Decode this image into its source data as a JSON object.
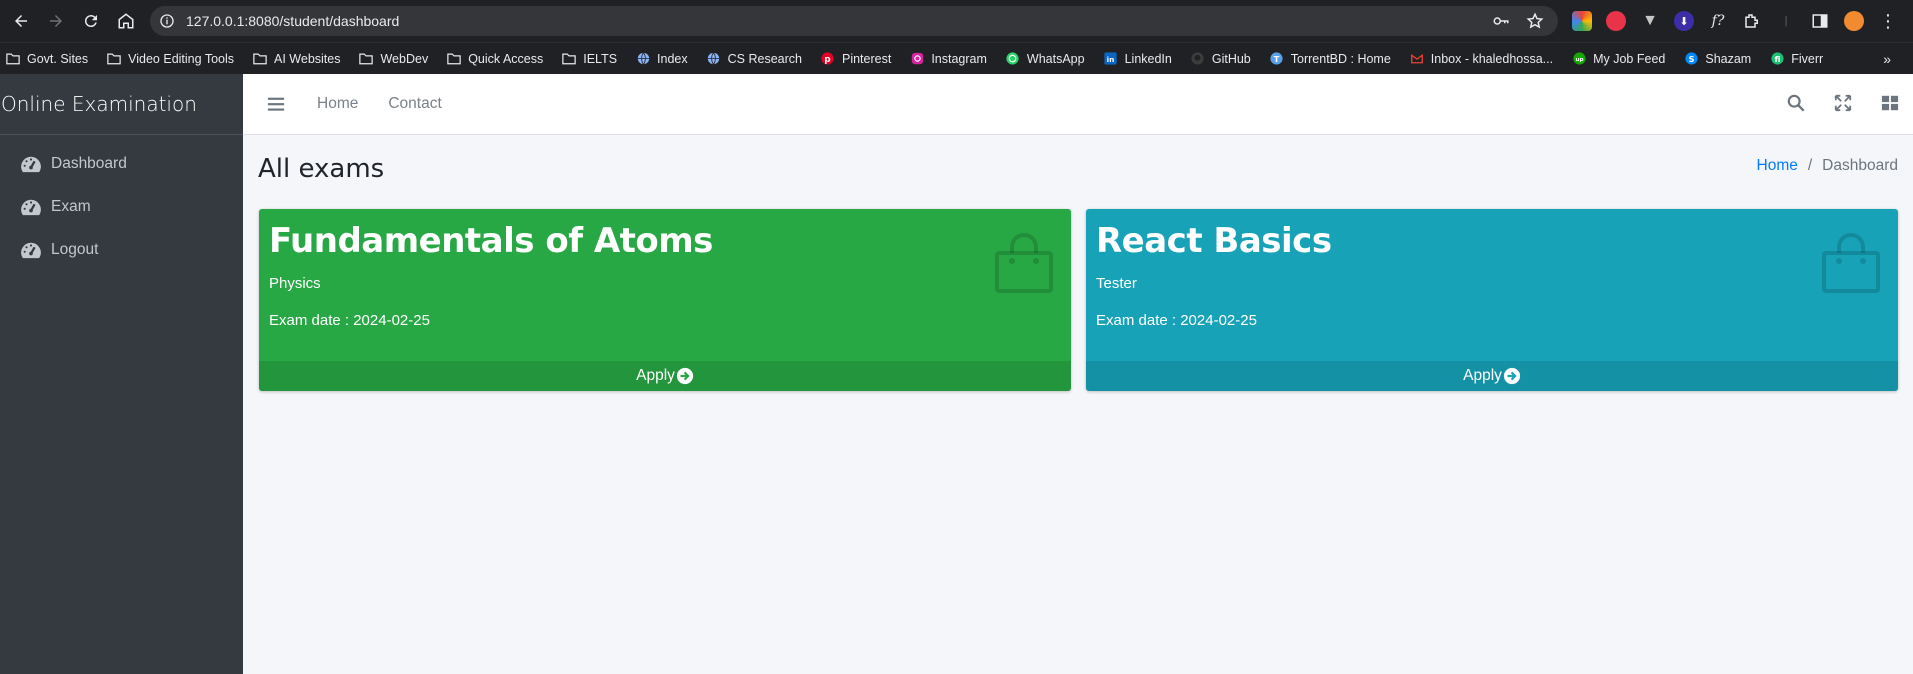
{
  "browser": {
    "url": "127.0.0.1:8080/student/dashboard",
    "bookmarks": [
      {
        "label": "Govt. Sites",
        "icon": "folder-icon"
      },
      {
        "label": "Video Editing Tools",
        "icon": "folder-icon"
      },
      {
        "label": "AI Websites",
        "icon": "folder-icon"
      },
      {
        "label": "WebDev",
        "icon": "folder-icon"
      },
      {
        "label": "Quick Access",
        "icon": "folder-icon"
      },
      {
        "label": "IELTS",
        "icon": "folder-icon"
      },
      {
        "label": "Index",
        "icon": "globe-icon"
      },
      {
        "label": "CS Research",
        "icon": "globe-icon"
      },
      {
        "label": "Pinterest",
        "icon": "pinterest-icon"
      },
      {
        "label": "Instagram",
        "icon": "instagram-icon"
      },
      {
        "label": "WhatsApp",
        "icon": "whatsapp-icon"
      },
      {
        "label": "LinkedIn",
        "icon": "linkedin-icon"
      },
      {
        "label": "GitHub",
        "icon": "github-icon"
      },
      {
        "label": "TorrentBD : Home",
        "icon": "torrentbd-icon"
      },
      {
        "label": "Inbox - khaledhossa...",
        "icon": "gmail-icon"
      },
      {
        "label": "My Job Feed",
        "icon": "upwork-icon"
      },
      {
        "label": "Shazam",
        "icon": "shazam-icon"
      },
      {
        "label": "Fiverr",
        "icon": "fiverr-icon"
      }
    ]
  },
  "sidebar": {
    "brand": "Online Examination",
    "items": [
      {
        "label": "Dashboard",
        "icon": "tachometer-icon"
      },
      {
        "label": "Exam",
        "icon": "tachometer-icon"
      },
      {
        "label": "Logout",
        "icon": "tachometer-icon"
      }
    ]
  },
  "topnav": {
    "links": [
      "Home",
      "Contact"
    ]
  },
  "content": {
    "title": "All exams",
    "breadcrumb": {
      "home": "Home",
      "current": "Dashboard"
    }
  },
  "exams": [
    {
      "title": "Fundamentals of Atoms",
      "subject": "Physics",
      "date": "Exam date : 2024-02-25",
      "action": "Apply",
      "color": "#28a745"
    },
    {
      "title": "React Basics",
      "subject": "Tester",
      "date": "Exam date : 2024-02-25",
      "action": "Apply",
      "color": "#17a2b8"
    }
  ],
  "colors": {
    "sidebar": "#343a40",
    "accent_link": "#007bff",
    "chrome": "#202124"
  }
}
